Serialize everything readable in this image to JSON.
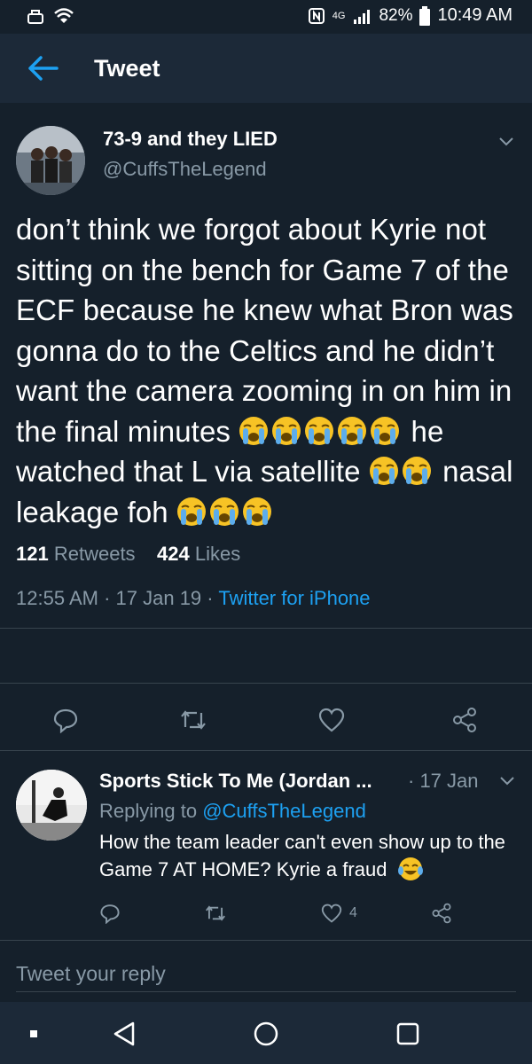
{
  "status_bar": {
    "battery_percent": "82%",
    "time": "10:49 AM",
    "network": "4G"
  },
  "header": {
    "title": "Tweet"
  },
  "tweet": {
    "author_name": "73-9 and they LIED",
    "author_handle": "@CuffsTheLegend",
    "text_parts": [
      "don’t think we forgot about Kyrie not sitting on the bench for Game 7 of the ECF because he knew what Bron was gonna do to the Celtics and he didn’t want the camera zooming in on him in the final minutes ",
      " he watched that L via satellite ",
      " nasal leakage foh "
    ],
    "emoji_name": "loudly-crying-face",
    "time": "12:55 AM",
    "date": "17 Jan 19",
    "source": "Twitter for iPhone",
    "retweets_count": "121",
    "retweets_label": "Retweets",
    "likes_count": "424",
    "likes_label": "Likes"
  },
  "reply": {
    "author_name": "Sports Stick To Me (Jordan ...",
    "date": "· 17 Jan",
    "replying_label": "Replying to",
    "replying_to": "@CuffsTheLegend",
    "text": "How the team leader can't even show up to the Game 7 AT HOME? Kyrie a fraud",
    "emoji_name": "face-with-tears-of-joy",
    "likes_count": "4"
  },
  "compose": {
    "placeholder": "Tweet your reply"
  },
  "colors": {
    "background": "#15202b",
    "bar": "#1c2938",
    "accent": "#1da1f2",
    "muted": "#8899a6",
    "divider": "#38444d"
  }
}
